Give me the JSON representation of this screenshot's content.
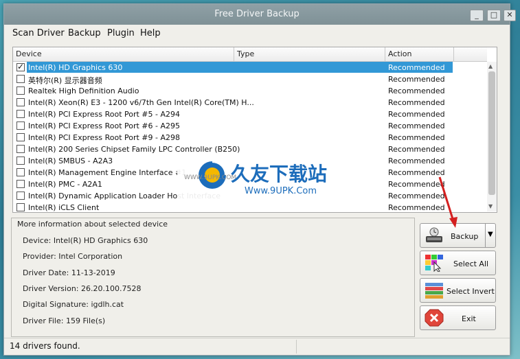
{
  "window": {
    "title": "Free Driver Backup"
  },
  "menu": [
    "Scan Driver",
    "Backup",
    "Plugin",
    "Help"
  ],
  "table": {
    "columns": [
      "Device",
      "Type",
      "Action"
    ],
    "rows": [
      {
        "device": "Intel(R) HD Graphics 630",
        "action": "Recommended",
        "checked": true,
        "selected": true
      },
      {
        "device": "英特尔(R) 显示器音频",
        "action": "Recommended",
        "checked": false
      },
      {
        "device": "Realtek High Definition Audio",
        "action": "Recommended",
        "checked": false
      },
      {
        "device": "Intel(R) Xeon(R) E3 - 1200 v6/7th Gen Intel(R) Core(TM) H...",
        "action": "Recommended",
        "checked": false
      },
      {
        "device": "Intel(R) PCI Express Root Port #5 - A294",
        "action": "Recommended",
        "checked": false
      },
      {
        "device": "Intel(R) PCI Express Root Port #6 - A295",
        "action": "Recommended",
        "checked": false
      },
      {
        "device": "Intel(R) PCI Express Root Port #9 - A298",
        "action": "Recommended",
        "checked": false
      },
      {
        "device": "Intel(R) 200 Series Chipset Family LPC Controller (B250)",
        "action": "Recommended",
        "checked": false
      },
      {
        "device": "Intel(R) SMBUS - A2A3",
        "action": "Recommended",
        "checked": false
      },
      {
        "device": "Intel(R) Management Engine Interface #1",
        "action": "Recommended",
        "checked": false
      },
      {
        "device": "Intel(R) PMC - A2A1",
        "action": "Recommended",
        "checked": false
      },
      {
        "device": "Intel(R) Dynamic Application Loader Host Interface",
        "action": "Recommended",
        "checked": false
      },
      {
        "device": "Intel(R) iCLS Client",
        "action": "Recommended",
        "checked": false
      }
    ]
  },
  "info": {
    "heading": "More information about selected device",
    "device": "Device:  Intel(R) HD Graphics 630",
    "provider": "Provider: Intel Corporation",
    "driver_date": "Driver Date: 11-13-2019",
    "driver_version": "Driver Version: 26.20.100.7528",
    "digital_signature": "Digital Signature: igdlh.cat",
    "driver_file": "Driver File: 159 File(s)"
  },
  "buttons": {
    "backup": "Backup",
    "select_all": "Select All",
    "select_invert": "Select Invert",
    "exit": "Exit"
  },
  "status": {
    "text": "14 drivers found."
  },
  "watermark": {
    "title": "久友下载站",
    "url": "Www.9UPK.Com",
    "url_small": "WWW.9UPK.COM"
  },
  "colors": {
    "selection": "#3298d6",
    "titlebar": "#8a9ba1",
    "exit_red": "#e0453a"
  }
}
